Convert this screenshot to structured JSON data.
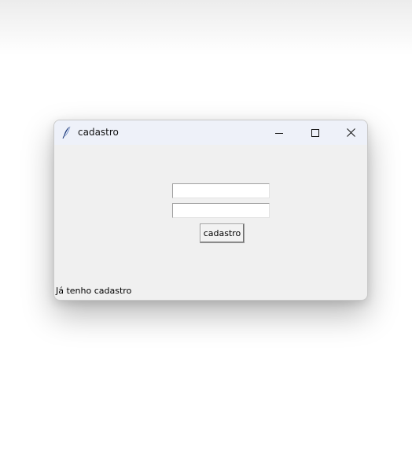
{
  "window": {
    "title": "cadastro",
    "app_icon": "feather-icon"
  },
  "titlebar_buttons": {
    "minimize_icon": "minimize-icon",
    "maximize_icon": "maximize-icon",
    "close_icon": "close-icon"
  },
  "form": {
    "field_1_value": "",
    "field_2_value": "",
    "submit_label": "cadastro",
    "login_link": "Já tenho cadastro"
  },
  "colors": {
    "titlebar": "#eef1f9",
    "client": "#f0f0f0",
    "entry_bg": "#ffffff"
  }
}
